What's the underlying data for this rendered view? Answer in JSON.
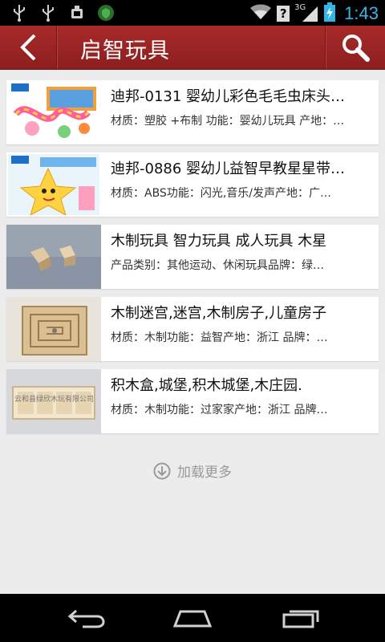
{
  "status_bar": {
    "time": "1:43",
    "network": "3G",
    "help_badge": "?"
  },
  "header": {
    "title": "启智玩具"
  },
  "items": [
    {
      "title": "迪邦-0131 婴幼儿彩色毛毛虫床头…",
      "subtitle": "材质：塑胶 +布制  功能：婴幼儿玩具 产地：…",
      "brand": "迪邦"
    },
    {
      "title": "迪邦-0886 婴幼儿益智早教星星带…",
      "subtitle": "材质：ABS功能：闪光,音乐/发声产地：广…",
      "brand": "迪邦"
    },
    {
      "title": "木制玩具 智力玩具 成人玩具 木星",
      "subtitle": "产品类别：其他运动、休闲玩具品牌：绿…"
    },
    {
      "title": "木制迷宫,迷宫,木制房子,儿童房子",
      "subtitle": "材质：木制功能：益智产地：浙江 品牌：…"
    },
    {
      "title": "积木盒,城堡,积木城堡,木庄园.",
      "subtitle": "材质：木制功能：过家家产地：浙江 品牌…",
      "watermark": "云和县绿欣木玩有限公司"
    }
  ],
  "load_more": {
    "label": "加载更多"
  },
  "colors": {
    "header": "#9c2525",
    "accent_time": "#33b5e5",
    "background": "#ececec"
  }
}
